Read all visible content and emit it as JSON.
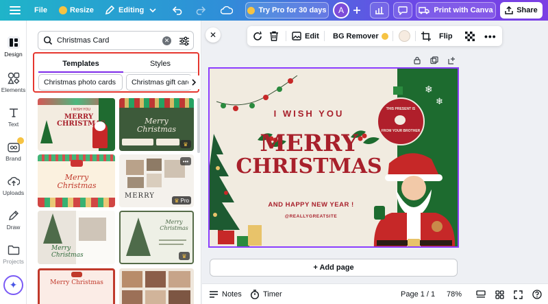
{
  "topbar": {
    "file_label": "File",
    "resize_label": "Resize",
    "editing_label": "Editing",
    "try_pro_label": "Try Pro for 30 days",
    "avatar_initial": "A",
    "print_label": "Print with Canva",
    "share_label": "Share"
  },
  "rail": {
    "items": [
      {
        "label": "Design",
        "icon": "layout-icon"
      },
      {
        "label": "Elements",
        "icon": "shapes-icon"
      },
      {
        "label": "Text",
        "icon": "text-icon"
      },
      {
        "label": "Brand",
        "icon": "brand-icon"
      },
      {
        "label": "Uploads",
        "icon": "cloud-upload-icon"
      },
      {
        "label": "Draw",
        "icon": "pen-icon"
      },
      {
        "label": "Projects",
        "icon": "folder-icon"
      }
    ]
  },
  "panel": {
    "search_value": "Christmas Card",
    "tabs": [
      {
        "label": "Templates",
        "active": true
      },
      {
        "label": "Styles",
        "active": false
      }
    ],
    "chips": [
      "Christmas photo cards",
      "Christmas gift cards"
    ],
    "templates": [
      {
        "title": "MERRY CHRISTMAS",
        "sub": "I WISH YOU",
        "pro": false,
        "crown": false
      },
      {
        "title": "Merry Christmas",
        "sub": "",
        "pro": false,
        "crown": true
      },
      {
        "title": "Merry Christmas",
        "sub": "",
        "pro": false,
        "crown": false
      },
      {
        "title": "MERRY",
        "sub": "",
        "pro": true,
        "crown": false
      },
      {
        "title": "Merry Christmas",
        "sub": "",
        "pro": false,
        "crown": false
      },
      {
        "title": "Merry Christmas",
        "sub": "",
        "pro": false,
        "crown": true
      },
      {
        "title": "Merry Christmas",
        "sub": "",
        "pro": false,
        "crown": false
      },
      {
        "title": "",
        "sub": "",
        "pro": false,
        "crown": false
      }
    ],
    "pro_label": "Pro"
  },
  "toolbar": {
    "edit_label": "Edit",
    "bg_remover_label": "BG Remover",
    "flip_label": "Flip",
    "swatch_color": "#f6ebe0"
  },
  "design": {
    "i_wish_you": "I WISH YOU",
    "merry": "MERRY",
    "christmas": "CHRISTMAS",
    "new_year": "AND HAPPY NEW YEAR !",
    "handle": "@REALLYGREATSITE",
    "badge_top": "THIS PRESENT IS",
    "badge_bottom": "FROM YOUR BROTHER",
    "colors": {
      "red": "#a8202b",
      "green": "#1d6b2f",
      "cream": "#f1ebe0"
    }
  },
  "canvas": {
    "add_page_label": "+ Add page"
  },
  "bottombar": {
    "notes_label": "Notes",
    "timer_label": "Timer",
    "page_label": "Page 1 / 1",
    "zoom_label": "78%"
  }
}
